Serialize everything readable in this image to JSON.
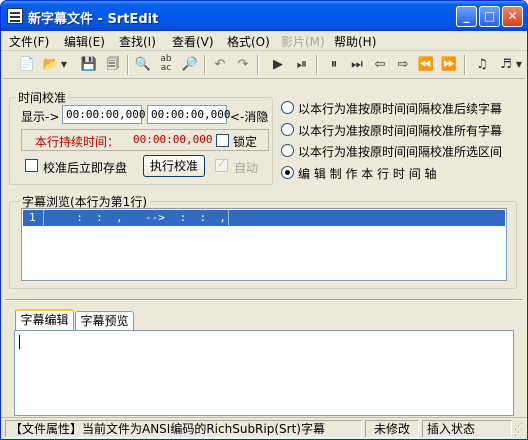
{
  "window": {
    "title": "新字幕文件 - SrtEdit"
  },
  "title_buttons": {
    "minimize": "_",
    "maximize": "□",
    "close": "✕"
  },
  "menu": [
    "文件(F)",
    "编辑(E)",
    "查找(I)",
    "查看(V)",
    "格式(O)",
    "影片(M)",
    "帮助(H)"
  ],
  "time_calibration": {
    "legend": "时间校准",
    "show_label": "显示->",
    "start_time": "00:00:00,000",
    "end_time": "00:00:00,000",
    "cancel_hide": "<-消隐",
    "duration_label": "本行持续时间：",
    "duration_value": "00:00:00,000",
    "lock_label": "锁定",
    "save_after_label": "校准后立即存盘",
    "execute_button": "执行校准",
    "auto_label": "自动"
  },
  "radio_options": [
    "以本行为准按原时间间隔校准后续字幕",
    "以本行为准按原时间间隔校准所有字幕",
    "以本行为准按原时间间隔校准所选区间",
    "编 辑 制 作 本 行 时 间 轴"
  ],
  "selected_option": 3,
  "browse": {
    "legend": "字幕浏览(本行为第1行)",
    "row": {
      "num": "1",
      "start": "  :  :  ,",
      "arrow": "-->",
      "end": " :  :  ,"
    }
  },
  "tabs": [
    "字幕编辑",
    "字幕预览"
  ],
  "active_tab": 0,
  "status": {
    "file_info": "【文件属性】当前文件为ANSI编码的RichSubRip(Srt)字幕",
    "modified": "未修改",
    "insert_mode": "插入状态"
  },
  "colors": {
    "duration_red": "#c00000",
    "selection_blue": "#316ac5",
    "title_blue": "#0058ee",
    "disabled_gray": "#a9a79a"
  }
}
